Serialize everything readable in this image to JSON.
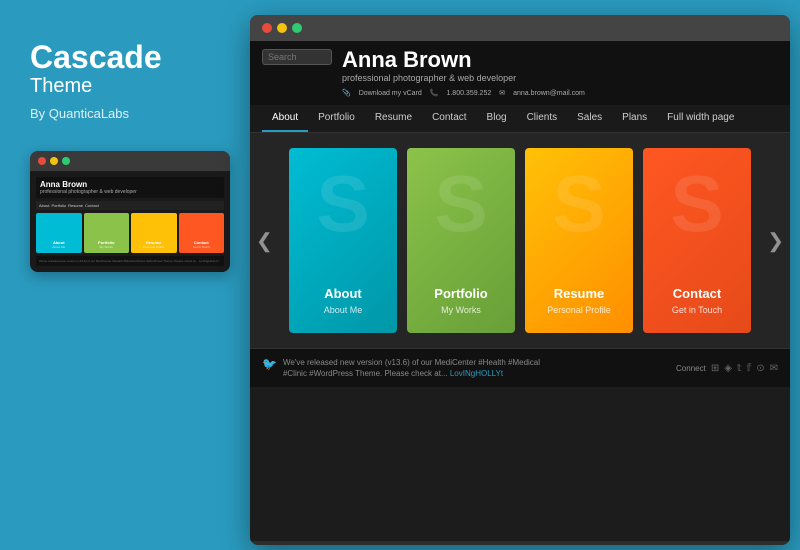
{
  "left": {
    "title": "Cascade",
    "subtitle": "Theme",
    "author": "By QuanticaLabs"
  },
  "small_preview": {
    "titlebar_dots": [
      "red",
      "yellow",
      "green"
    ],
    "person_name": "Anna Brown",
    "person_tagline": "professional photographer & web developer",
    "nav_items": [
      "About",
      "Portfolio",
      "Resume",
      "Contact"
    ],
    "cards": [
      {
        "label": "About",
        "sub": "About Me",
        "color": "#00bcd4"
      },
      {
        "label": "Portfolio",
        "sub": "My Works",
        "color": "#8bc34a"
      },
      {
        "label": "Resume",
        "sub": "Personal Profile",
        "color": "#ffc107"
      },
      {
        "label": "Contact",
        "sub": "Get in Touch",
        "color": "#ff5722"
      }
    ],
    "footer_text": "We've released new version (v13.6) of our MediCenter #Health #Medical #Clinic #WordPress Theme. Please check at... LovINgHOLLYt"
  },
  "large_preview": {
    "titlebar_dots": [
      "red",
      "yellow",
      "green"
    ],
    "search_placeholder": "Search",
    "person_name": "Anna Brown",
    "person_tagline": "professional photographer & web developer",
    "contact_vcard": "Download my vCard",
    "contact_phone": "1.800.359.252",
    "contact_email": "anna.brown@mail.com",
    "nav_items": [
      {
        "label": "About",
        "active": true
      },
      {
        "label": "Portfolio",
        "active": false
      },
      {
        "label": "Resume",
        "active": false
      },
      {
        "label": "Contact",
        "active": false
      },
      {
        "label": "Blog",
        "active": false
      },
      {
        "label": "Clients",
        "active": false
      },
      {
        "label": "Sales",
        "active": false
      },
      {
        "label": "Plans",
        "active": false
      },
      {
        "label": "Full width page",
        "active": false
      }
    ],
    "cards": [
      {
        "title": "About",
        "subtitle": "About Me",
        "color_class": "card-blue"
      },
      {
        "title": "Portfolio",
        "subtitle": "My Works",
        "color_class": "card-green"
      },
      {
        "title": "Resume",
        "subtitle": "Personal Profile",
        "color_class": "card-yellow"
      },
      {
        "title": "Contact",
        "subtitle": "Get in Touch",
        "color_class": "card-orange"
      }
    ],
    "arrow_left": "❮",
    "arrow_right": "❯",
    "tweet_text": "We've released new version (v13.6) of our MediCenter #Health #Medical #Clinic #WordPress Theme. Please check at...",
    "tweet_link": "LovINgHOLLYt",
    "connect_label": "Connect",
    "social_icons": [
      "rss",
      "feed",
      "twitter",
      "facebook",
      "instagram",
      "mail"
    ]
  }
}
